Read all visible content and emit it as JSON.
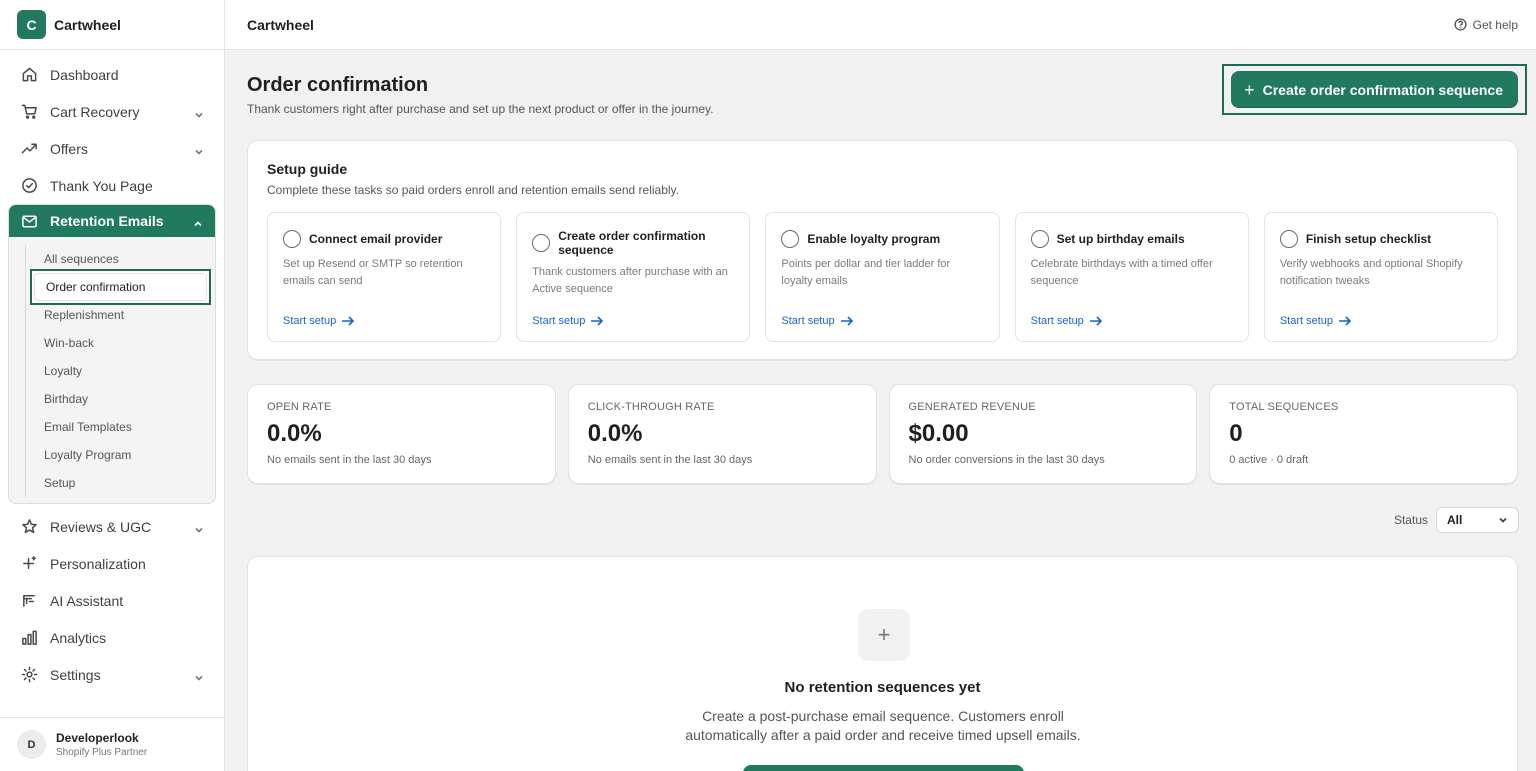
{
  "app": {
    "logo_letter": "C",
    "name": "Cartwheel"
  },
  "topbar": {
    "title": "Cartwheel",
    "help_label": "Get help"
  },
  "sidebar": {
    "items_top": [
      {
        "label": "Dashboard",
        "icon": "home-icon"
      },
      {
        "label": "Cart Recovery",
        "icon": "cart-icon",
        "expandable": true
      },
      {
        "label": "Offers",
        "icon": "trend-icon",
        "expandable": true
      },
      {
        "label": "Thank You Page",
        "icon": "check-circle-icon"
      }
    ],
    "group": {
      "label": "Retention Emails",
      "icon": "mail-icon",
      "items": [
        "All sequences",
        "Order confirmation",
        "Replenishment",
        "Win-back",
        "Loyalty",
        "Birthday",
        "Email Templates",
        "Loyalty Program",
        "Setup"
      ],
      "active": "Order confirmation"
    },
    "items_bottom": [
      {
        "label": "Reviews & UGC",
        "icon": "star-icon",
        "expandable": true
      },
      {
        "label": "Personalization",
        "icon": "sparkle-icon"
      },
      {
        "label": "AI Assistant",
        "icon": "ai-icon"
      },
      {
        "label": "Analytics",
        "icon": "bar-chart-icon"
      },
      {
        "label": "Settings",
        "icon": "gear-icon",
        "expandable": true
      }
    ],
    "user": {
      "initial": "D",
      "name": "Developerlook",
      "role": "Shopify Plus Partner"
    }
  },
  "page": {
    "title": "Order confirmation",
    "subtitle": "Thank customers right after purchase and set up the next product or offer in the journey.",
    "primary_button": "Create order confirmation sequence"
  },
  "setup_guide": {
    "title": "Setup guide",
    "subtitle": "Complete these tasks so paid orders enroll and retention emails send reliably.",
    "tasks": [
      {
        "title": "Connect email provider",
        "desc": "Set up Resend or SMTP so retention emails can send",
        "link": "Start setup"
      },
      {
        "title": "Create order confirmation sequence",
        "desc": "Thank customers after purchase with an Active sequence",
        "link": "Start setup"
      },
      {
        "title": "Enable loyalty program",
        "desc": "Points per dollar and tier ladder for loyalty emails",
        "link": "Start setup"
      },
      {
        "title": "Set up birthday emails",
        "desc": "Celebrate birthdays with a timed offer sequence",
        "link": "Start setup"
      },
      {
        "title": "Finish setup checklist",
        "desc": "Verify webhooks and optional Shopify notification tweaks",
        "link": "Start setup"
      }
    ]
  },
  "stats": [
    {
      "label": "OPEN RATE",
      "value": "0.0%",
      "note": "No emails sent in the last 30 days"
    },
    {
      "label": "CLICK-THROUGH RATE",
      "value": "0.0%",
      "note": "No emails sent in the last 30 days"
    },
    {
      "label": "GENERATED REVENUE",
      "value": "$0.00",
      "note": "No order conversions in the last 30 days"
    },
    {
      "label": "TOTAL SEQUENCES",
      "value": "0",
      "note": "0 active · 0 draft"
    }
  ],
  "filter": {
    "label": "Status",
    "value": "All"
  },
  "empty_state": {
    "icon": "+",
    "title": "No retention sequences yet",
    "desc": "Create a post-purchase email sequence. Customers enroll automatically after a paid order and receive timed upsell emails."
  },
  "colors": {
    "brand": "#217a5f",
    "link": "#1a64c0",
    "focus_outline": "#1d6b53"
  }
}
